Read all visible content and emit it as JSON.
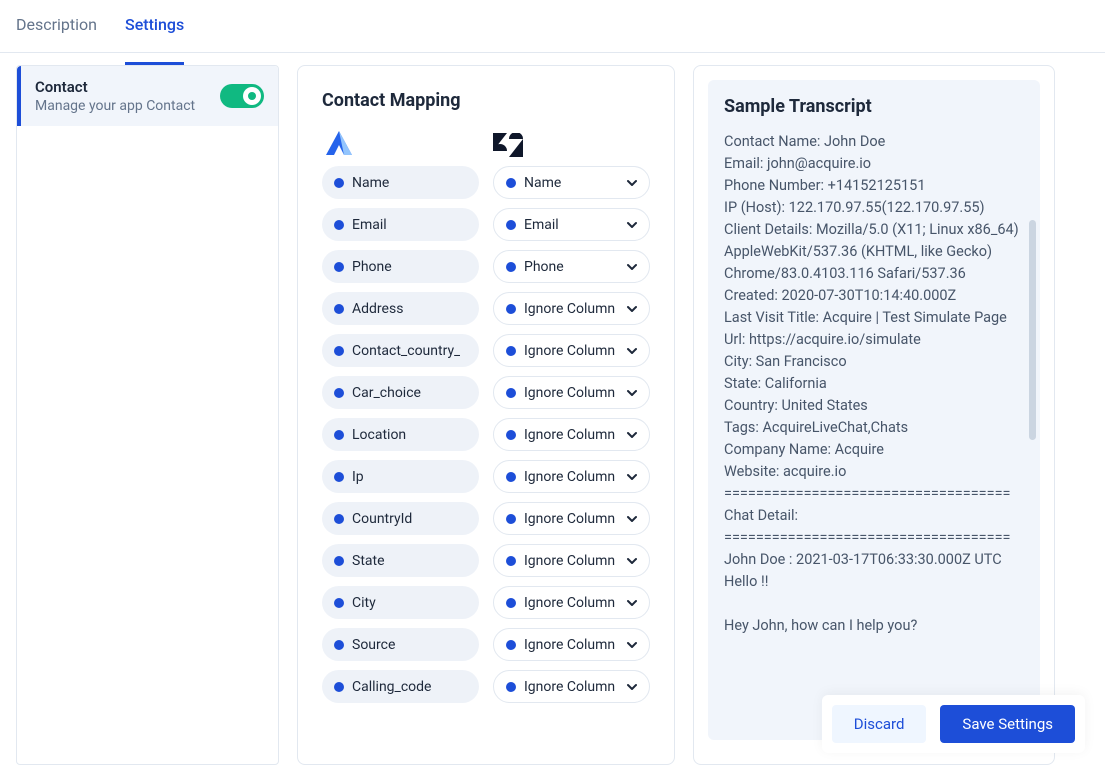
{
  "tabs": {
    "description": "Description",
    "settings": "Settings"
  },
  "sidebar": {
    "title": "Contact",
    "subtitle": "Manage your app Contact"
  },
  "mapping": {
    "title": "Contact Mapping",
    "left": [
      "Name",
      "Email",
      "Phone",
      "Address",
      "Contact_country_",
      "Car_choice",
      "Location",
      "Ip",
      "CountryId",
      "State",
      "City",
      "Source",
      "Calling_code"
    ],
    "right": [
      "Name",
      "Email",
      "Phone",
      "Ignore Column",
      "Ignore Column",
      "Ignore Column",
      "Ignore Column",
      "Ignore Column",
      "Ignore Column",
      "Ignore Column",
      "Ignore Column",
      "Ignore Column",
      "Ignore Column"
    ]
  },
  "transcript": {
    "title": "Sample Transcript",
    "lines": [
      "Contact Name: John Doe",
      "Email: john@acquire.io",
      "Phone Number: +14152125151",
      "IP (Host): 122.170.97.55(122.170.97.55)",
      "Client Details: Mozilla/5.0 (X11; Linux x86_64) AppleWebKit/537.36 (KHTML, like Gecko) Chrome/83.0.4103.116 Safari/537.36",
      "Created: 2020-07-30T10:14:40.000Z",
      "Last Visit Title: Acquire | Test Simulate Page",
      "Url: https://acquire.io/simulate",
      "City: San Francisco",
      "State: California",
      "Country: United States",
      "Tags: AcquireLiveChat,Chats",
      "Company Name: Acquire",
      "Website: acquire.io",
      "====================================",
      "Chat Detail:",
      "====================================",
      "John Doe : 2021-03-17T06:33:30.000Z UTC",
      "Hello !!",
      "",
      "Hey John, how can I help you?"
    ]
  },
  "footer": {
    "discard": "Discard",
    "save": "Save Settings"
  }
}
